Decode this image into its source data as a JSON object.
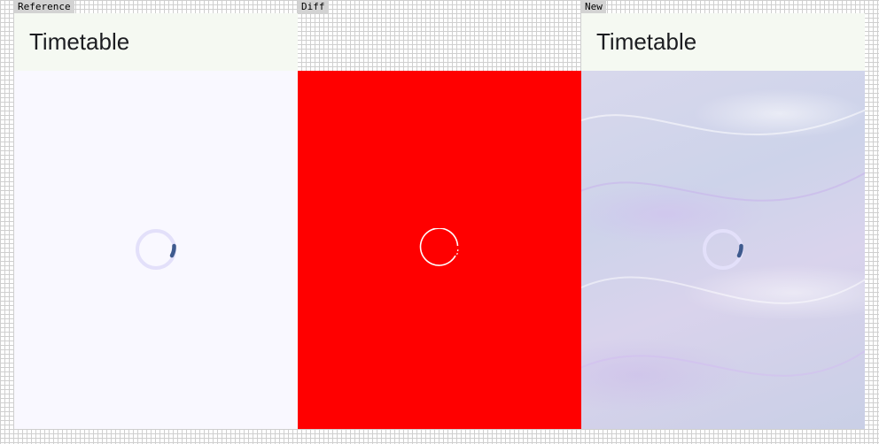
{
  "panels": {
    "reference": {
      "label": "Reference",
      "app_title": "Timetable"
    },
    "diff": {
      "label": "Diff"
    },
    "new": {
      "label": "New",
      "app_title": "Timetable"
    }
  },
  "spinner": {
    "track_color": "#e3e0fa",
    "indicator_color": "#3e5a8e",
    "diff_outline_color": "#ffffff",
    "icon": "circular-progress-icon"
  },
  "colors": {
    "app_bar_bg": "#f5f9f2",
    "content_bg": "#f9f8ff",
    "diff_bg": "#ff0000",
    "label_bg": "#d3d3d3"
  }
}
